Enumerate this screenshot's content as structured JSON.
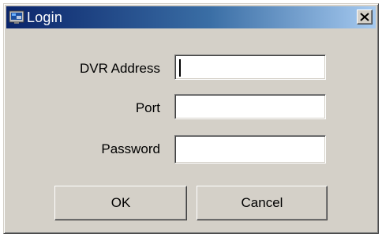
{
  "window": {
    "title": "Login",
    "close_glyph": "✕",
    "title_icon": "dvr-monitor-icon",
    "title_gradient": [
      "#0a246a",
      "#3a6ea5",
      "#a6caf0"
    ],
    "face_color": "#d4d0c8"
  },
  "form": {
    "address_label": "DVR Address",
    "address_value": "",
    "port_label": "Port",
    "port_value": "",
    "password_label": "Password",
    "password_value": ""
  },
  "buttons": {
    "ok_label": "OK",
    "cancel_label": "Cancel"
  }
}
